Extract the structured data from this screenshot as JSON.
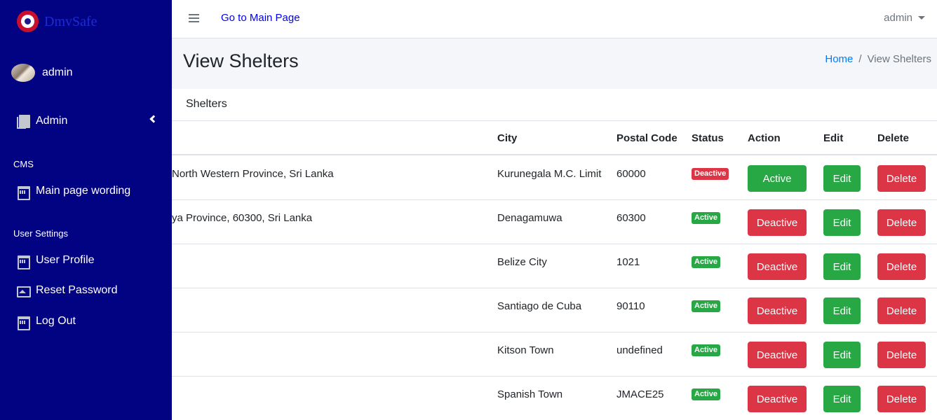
{
  "brand": {
    "name": "DmvSafe"
  },
  "sidebar": {
    "user_name": "admin",
    "admin_label": "Admin",
    "cms_header": "CMS",
    "main_page_wording": "Main page wording",
    "user_settings_header": "User Settings",
    "user_profile": "User Profile",
    "reset_password": "Reset Password",
    "log_out": "Log Out"
  },
  "topbar": {
    "main_link": "Go to Main Page",
    "user_menu": "admin"
  },
  "header": {
    "title": "View Shelters",
    "breadcrumb_home": "Home",
    "breadcrumb_sep": "/",
    "breadcrumb_current": "View Shelters"
  },
  "card": {
    "title": "Shelters"
  },
  "table": {
    "columns": {
      "city": "City",
      "postal": "Postal Code",
      "status": "Status",
      "action": "Action",
      "edit": "Edit",
      "delete": "Delete"
    },
    "rows": [
      {
        "address": "North Western Province, Sri Lanka",
        "city": "Kurunegala M.C. Limit",
        "postal": "60000",
        "status": "Deactive",
        "action": "Active",
        "edit": "Edit",
        "delete": "Delete"
      },
      {
        "address": "ya Province, 60300, Sri Lanka",
        "city": "Denagamuwa",
        "postal": "60300",
        "status": "Active",
        "action": "Deactive",
        "edit": "Edit",
        "delete": "Delete"
      },
      {
        "address": "",
        "city": "Belize City",
        "postal": "1021",
        "status": "Active",
        "action": "Deactive",
        "edit": "Edit",
        "delete": "Delete"
      },
      {
        "address": "",
        "city": "Santiago de Cuba",
        "postal": "90110",
        "status": "Active",
        "action": "Deactive",
        "edit": "Edit",
        "delete": "Delete"
      },
      {
        "address": "",
        "city": "Kitson Town",
        "postal": "undefined",
        "status": "Active",
        "action": "Deactive",
        "edit": "Edit",
        "delete": "Delete"
      },
      {
        "address": "",
        "city": "Spanish Town",
        "postal": "JMACE25",
        "status": "Active",
        "action": "Deactive",
        "edit": "Edit",
        "delete": "Delete"
      }
    ]
  },
  "colors": {
    "sidebar_bg": "#020382",
    "success": "#28a745",
    "danger": "#dc3545",
    "link": "#007bff"
  }
}
